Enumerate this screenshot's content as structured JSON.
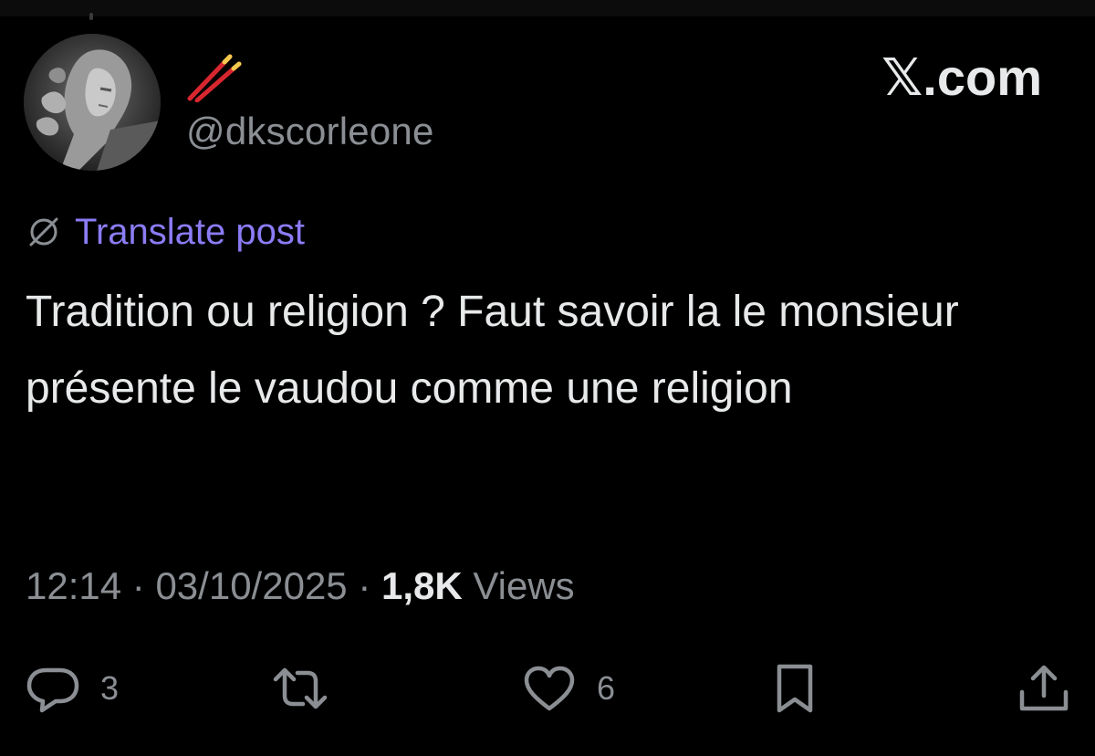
{
  "header": {
    "handle": "@dkscorleone",
    "brand": {
      "mark": "𝕏",
      "suffix": ".com"
    }
  },
  "translate": {
    "label": "Translate post"
  },
  "post": {
    "text": "Tradition ou religion ? Faut savoir la le monsieur présente le vaudou comme une religion"
  },
  "meta": {
    "time": "12:14",
    "separator": "·",
    "date": "03/10/2025",
    "views_count": "1,8K",
    "views_label": "Views"
  },
  "actions": {
    "reply_count": "3",
    "like_count": "6"
  },
  "icons": {
    "name_emoji": "chopsticks-icon",
    "translate": "globe-icon",
    "reply": "comment-icon",
    "repost": "repost-icon",
    "like": "heart-icon",
    "bookmark": "bookmark-icon",
    "share": "share-icon"
  },
  "colors": {
    "background": "#000000",
    "text": "#e7e9ea",
    "secondary": "#8b8f94",
    "link": "#8b7cf6",
    "chopsticks": "#d8262f"
  }
}
